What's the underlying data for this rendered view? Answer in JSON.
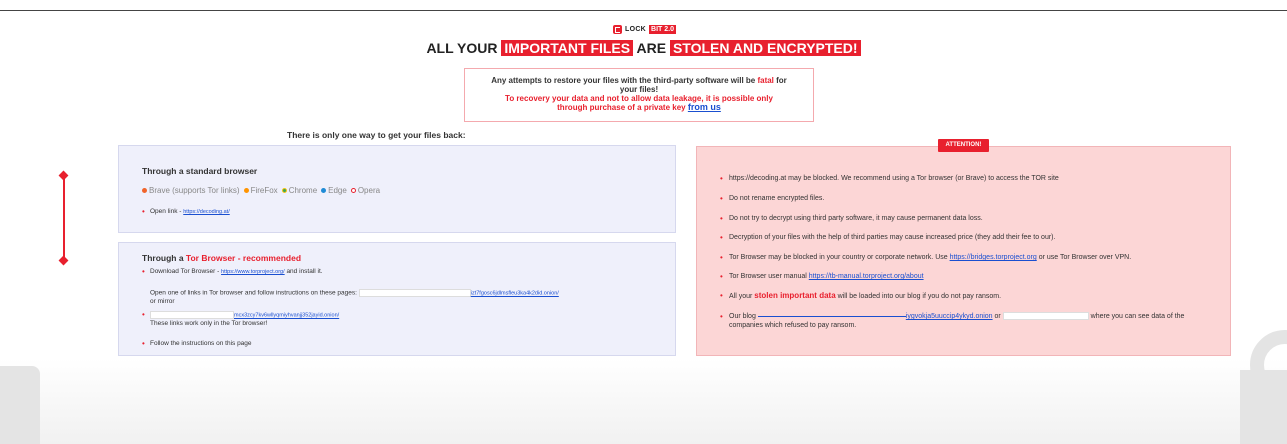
{
  "logo": {
    "name": "LOCK",
    "version": "BIT 2.0"
  },
  "headline": {
    "part1": "ALL YOUR ",
    "highlight1": "IMPORTANT FILES",
    "part2": " ARE ",
    "highlight2": "STOLEN AND ENCRYPTED!"
  },
  "warning": {
    "line1_a": "Any attempts to restore your files with the third-party software will be ",
    "line1_fatal": "fatal",
    "line1_b": " for",
    "line2": "your files!",
    "line3": "To recovery your data and not to allow data leakage, it is possible only",
    "line4": "through purchase of a private key ",
    "link": "from us"
  },
  "one_way_title": "There is only one way to get your files back:",
  "standard": {
    "title": "Through a standard browser",
    "browsers": [
      "Brave (supports Tor links)",
      "FireFox",
      "Chrome",
      "Edge",
      "Opera"
    ],
    "open_link_label": "Open link - ",
    "open_link": "https://decoding.at/"
  },
  "tor": {
    "title_a": "Through a ",
    "title_b": "Tor Browser - recommended",
    "download_a": "Download Tor Browser - ",
    "download_link": "https://www.torproject.org/",
    "download_b": " and install it.",
    "open_text": "Open one of links in Tor browser and follow instructions on these pages: ",
    "onion1": "izt7fgosc6jdlmsfleu3ka4k2did.onion/",
    "or_mirror": "or mirror",
    "onion2": "mcx3zcy7kv6wllyqmiyhvanjj352jayid.onion/",
    "only_tor": "These links work only in the Tor browser!",
    "follow": "Follow the instructions on this page"
  },
  "attention": {
    "badge": "ATTENTION!",
    "items": [
      "https://decoding.at may be blocked. We recommend using a Tor browser (or Brave) to access the TOR site",
      "Do not rename encrypted files.",
      "Do not try to decrypt using third party software, it may cause permanent data loss.",
      "Decryption of your files with the help of third parties may cause increased price (they add their fee to our)."
    ],
    "tor_blocked_a": "Tor Browser may be blocked in your country or corporate network. Use ",
    "tor_blocked_link": "https://bridges.torproject.org",
    "tor_blocked_b": " or use Tor Browser over VPN.",
    "manual_a": "Tor Browser user manual ",
    "manual_link": "https://tb-manual.torproject.org/about",
    "stolen_a": "All your ",
    "stolen_red": "stolen important data",
    "stolen_b": " will be loaded into our blog if you do not pay ransom.",
    "blog_a": "Our blog ",
    "blog_link": "iygvokja5uuccip4ykyd.onion",
    "blog_or": " or ",
    "blog_b": " where you can see data of the",
    "blog_c": "companies which refused to pay ransom."
  }
}
